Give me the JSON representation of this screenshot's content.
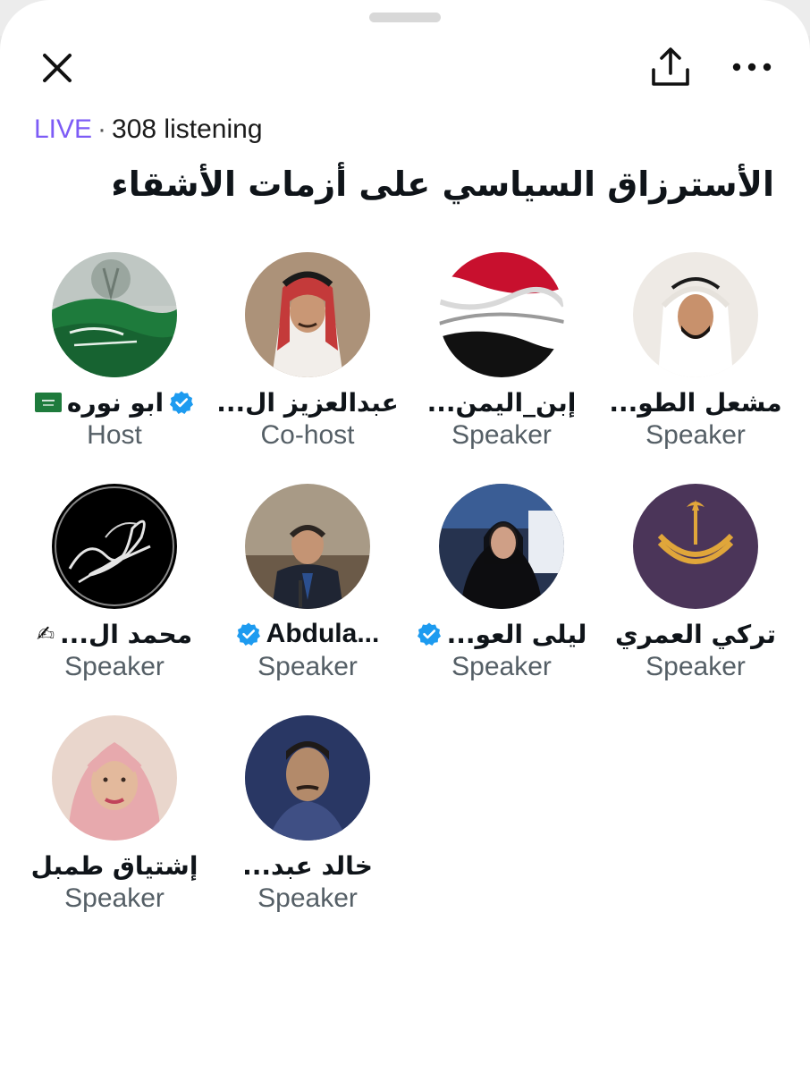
{
  "header": {
    "close_icon": "close-icon",
    "share_icon": "share-icon",
    "more_icon": "more-horizontal-icon"
  },
  "space": {
    "status": "LIVE",
    "listening": "308 listening",
    "title": "الأسترزاق السياسي على أزمات الأشقاء"
  },
  "participants": [
    {
      "name": "ابو نوره",
      "role": "Host",
      "verified": true,
      "emoji": "saudi-flag"
    },
    {
      "name": "عبدالعزيز ال...",
      "role": "Co-host",
      "verified": false
    },
    {
      "name": "إبن_اليمن...",
      "role": "Speaker",
      "verified": false
    },
    {
      "name": "مشعل الطو...",
      "role": "Speaker",
      "verified": false
    },
    {
      "name": "محمد ال...",
      "role": "Speaker",
      "verified": false,
      "suffix": "✍"
    },
    {
      "name": "Abdula...",
      "role": "Speaker",
      "verified": true
    },
    {
      "name": "ليلى العو...",
      "role": "Speaker",
      "verified": true
    },
    {
      "name": "تركي العمري",
      "role": "Speaker",
      "verified": false
    },
    {
      "name": "إشتياق طمبل",
      "role": "Speaker",
      "verified": false
    },
    {
      "name": "خالد عبد...",
      "role": "Speaker",
      "verified": false
    }
  ],
  "colors": {
    "live": "#7d5cf6",
    "verified": "#1d9bf0",
    "role": "#555f66"
  }
}
